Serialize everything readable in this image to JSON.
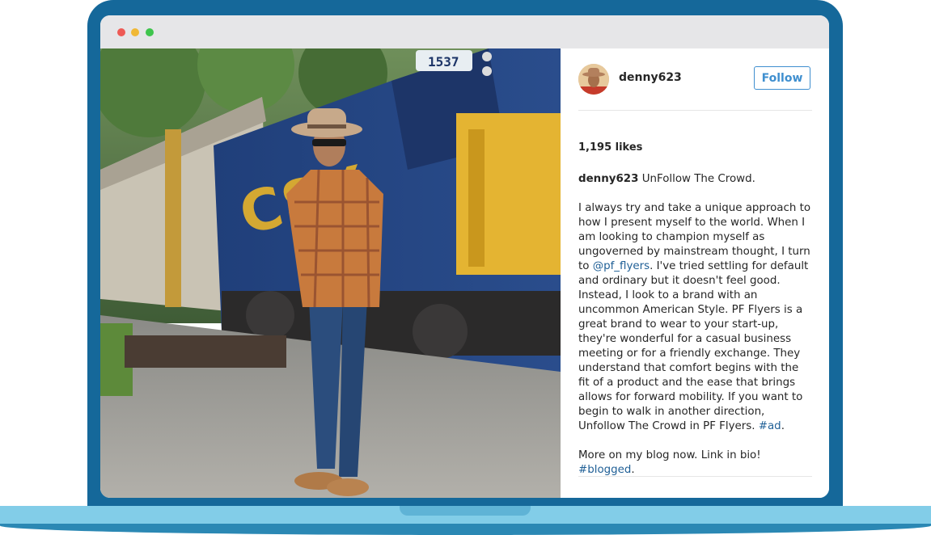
{
  "post": {
    "username": "denny623",
    "follow_label": "Follow",
    "likes": "1,195 likes",
    "caption_title": "UnFollow The Crowd.",
    "paragraph1_before": "I always try and take a unique approach to how I present myself to the world. When I am looking to champion myself as ungoverned by mainstream thought, I turn to ",
    "mention": "@pf_flyers",
    "paragraph1_middle": ". I've tried settling for default and ordinary but it doesn't feel good. Instead, I look to a brand with an uncommon American Style. PF Flyers is a great brand to wear to your start-up, they're wonderful for a casual business meeting or for a friendly exchange. They understand that comfort begins with the fit of a product and the ease that brings allows for forward mobility. If you want to begin to walk in another direction, Unfollow The Crowd in PF Flyers. ",
    "hashtag1": "#ad",
    "paragraph1_end": ".",
    "paragraph2": "More on my blog now. Link in bio!",
    "hashtag2": "#blogged",
    "paragraph2_end": "."
  },
  "photo": {
    "locomotive_number": "1537",
    "locomotive_brand": "CSX"
  },
  "colors": {
    "laptop": "#15689a",
    "link": "#1f5f96",
    "follow": "#3f8fcf"
  }
}
